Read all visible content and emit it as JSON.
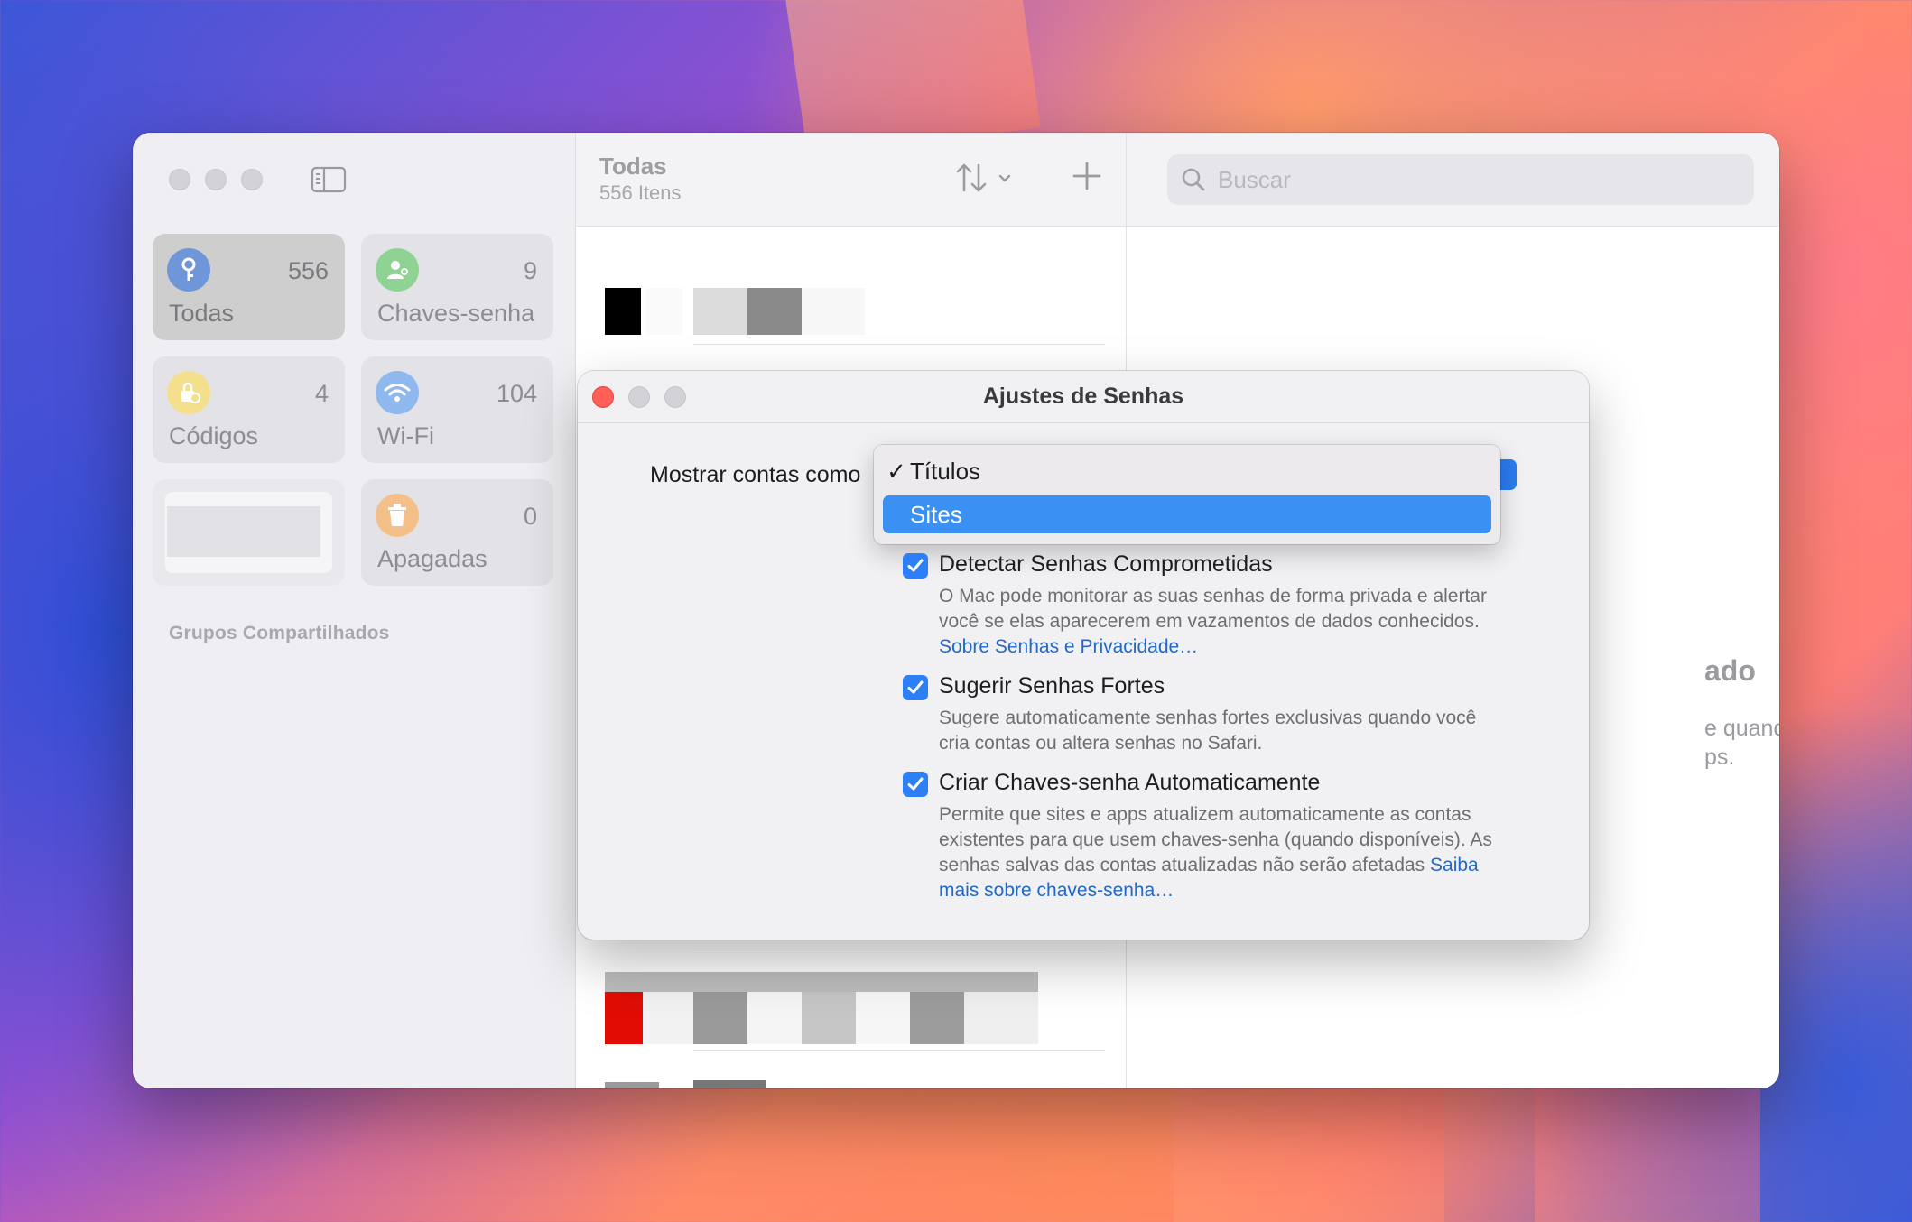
{
  "window": {
    "sidebar": {
      "tiles": [
        {
          "label": "Todas",
          "count": "556",
          "icon": "key-icon",
          "color": "#2f7cf6"
        },
        {
          "label": "Chaves-senha",
          "count": "9",
          "icon": "person-key-icon",
          "color": "#3cc04a"
        },
        {
          "label": "Códigos",
          "count": "4",
          "icon": "lock-clock-icon",
          "color": "#f5c518"
        },
        {
          "label": "Wi-Fi",
          "count": "104",
          "icon": "wifi-icon",
          "color": "#2f8bf6"
        },
        {
          "label": "Apagadas",
          "count": "0",
          "icon": "trash-icon",
          "color": "#f39a3a"
        }
      ],
      "group_title": "Grupos Compartilhados"
    },
    "list": {
      "title": "Todas",
      "subtitle": "556 Itens"
    },
    "detail": {
      "search_placeholder": "Buscar",
      "empty_title_fragment": "ado",
      "empty_text_fragment": "e quando você\nps."
    }
  },
  "dialog": {
    "title": "Ajustes de Senhas",
    "show_accounts_label": "Mostrar contas como",
    "menu": {
      "items": [
        {
          "label": "Títulos",
          "checked": true
        },
        {
          "label": "Sites",
          "highlighted": true
        }
      ]
    },
    "options": [
      {
        "title": "Detectar Senhas Comprometidas",
        "desc": "O Mac pode monitorar as suas senhas de forma privada e alertar você se elas aparecerem em vazamentos de dados conhecidos.",
        "link": "Sobre Senhas e Privacidade…",
        "checked": true
      },
      {
        "title": "Sugerir Senhas Fortes",
        "desc": "Sugere automaticamente senhas fortes exclusivas quando você cria contas ou altera senhas no Safari.",
        "link": "",
        "checked": true
      },
      {
        "title": "Criar Chaves-senha Automaticamente",
        "desc": "Permite que sites e apps atualizem automaticamente as contas existentes para que usem chaves-senha (quando disponíveis). As senhas salvas das contas atualizadas não serão afetadas",
        "link": "Saiba mais sobre chaves-senha…",
        "checked": true
      }
    ]
  },
  "colors": {
    "accent": "#2d7ff6",
    "menu_highlight": "#3b90f4",
    "link": "#2269c8",
    "close_button": "#ff5f57"
  }
}
